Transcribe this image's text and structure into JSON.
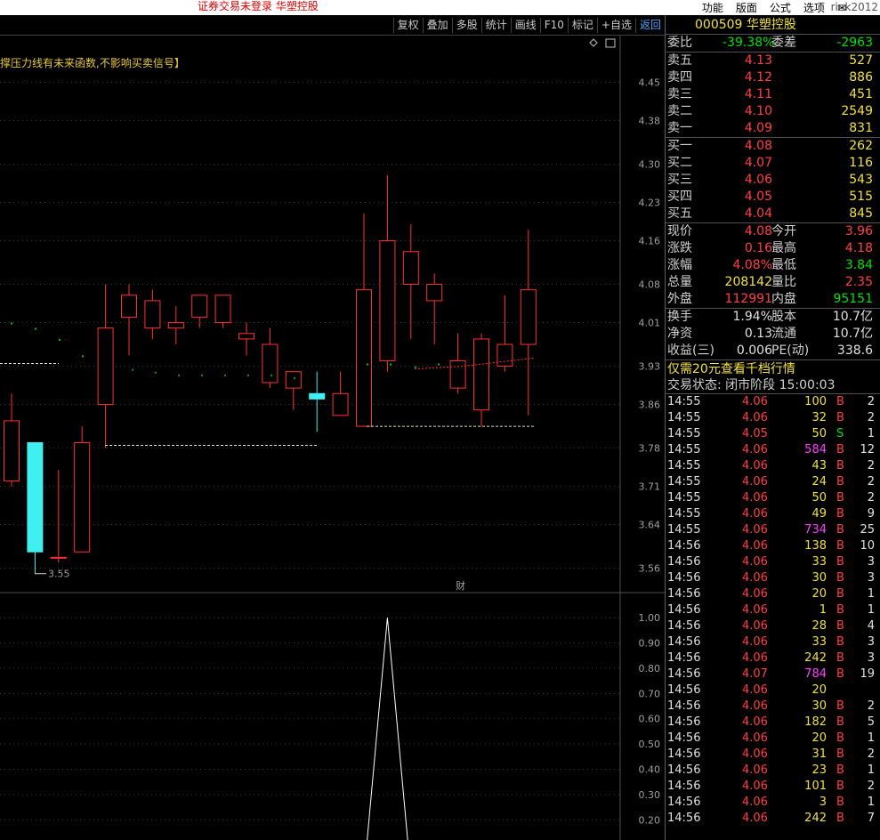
{
  "topbar": {
    "warning": "证券交易未登录  华塑控股",
    "menu": [
      "功能",
      "版面",
      "公式",
      "选项"
    ],
    "user": "rink2012"
  },
  "toolbar": {
    "buttons": [
      "复权",
      "叠加",
      "多股",
      "统计",
      "画线",
      "F10",
      "标记",
      "+自选",
      "返回"
    ],
    "active": "返回"
  },
  "chart": {
    "indicator_note": "撑压力线有未来函数,不影响买卖信号】",
    "price_axis_labels": [
      "4.45",
      "4.38",
      "4.30",
      "4.23",
      "4.16",
      "4.08",
      "4.01",
      "3.93",
      "3.86",
      "3.78",
      "3.71",
      "3.64",
      "3.56"
    ],
    "low_marker": "3.55",
    "finance_marker": "财",
    "sub_axis_labels": [
      "1.00",
      "0.90",
      "0.80",
      "0.70",
      "0.60",
      "0.50",
      "0.40",
      "0.30",
      "0.20"
    ],
    "colors": {
      "up": "#ff3030",
      "down": "#40f0f0",
      "axis": "#a0a0a0",
      "grid": "#505050"
    }
  },
  "chart_data": {
    "type": "candlestick",
    "title": "",
    "ylim": [
      3.53,
      4.49
    ],
    "candles": [
      {
        "o": 3.72,
        "c": 3.83,
        "h": 3.88,
        "l": 3.71
      },
      {
        "o": 3.79,
        "c": 3.59,
        "h": 3.79,
        "l": 3.55
      },
      {
        "o": 3.58,
        "c": 3.58,
        "h": 3.74,
        "l": 3.57
      },
      {
        "o": 3.59,
        "c": 3.79,
        "h": 3.82,
        "l": 3.59
      },
      {
        "o": 3.86,
        "c": 4.0,
        "h": 4.08,
        "l": 3.78
      },
      {
        "o": 4.02,
        "c": 4.06,
        "h": 4.08,
        "l": 3.95
      },
      {
        "o": 4.0,
        "c": 4.05,
        "h": 4.07,
        "l": 3.98
      },
      {
        "o": 4.0,
        "c": 4.01,
        "h": 4.04,
        "l": 3.97
      },
      {
        "o": 4.02,
        "c": 4.06,
        "h": 4.06,
        "l": 4.0
      },
      {
        "o": 4.01,
        "c": 4.06,
        "h": 4.06,
        "l": 4.0
      },
      {
        "o": 3.98,
        "c": 3.99,
        "h": 4.01,
        "l": 3.95
      },
      {
        "o": 3.9,
        "c": 3.97,
        "h": 4.0,
        "l": 3.89
      },
      {
        "o": 3.89,
        "c": 3.92,
        "h": 3.92,
        "l": 3.85
      },
      {
        "o": 3.88,
        "c": 3.87,
        "h": 3.92,
        "l": 3.81
      },
      {
        "o": 3.84,
        "c": 3.88,
        "h": 3.92,
        "l": 3.84
      },
      {
        "o": 3.82,
        "c": 4.07,
        "h": 4.21,
        "l": 3.82
      },
      {
        "o": 3.94,
        "c": 4.16,
        "h": 4.28,
        "l": 3.92
      },
      {
        "o": 4.08,
        "c": 4.14,
        "h": 4.19,
        "l": 3.98
      },
      {
        "o": 4.05,
        "c": 4.08,
        "h": 4.1,
        "l": 3.97
      },
      {
        "o": 3.89,
        "c": 3.94,
        "h": 3.99,
        "l": 3.88
      },
      {
        "o": 3.85,
        "c": 3.98,
        "h": 3.99,
        "l": 3.82
      },
      {
        "o": 3.93,
        "c": 3.97,
        "h": 4.06,
        "l": 3.92
      },
      {
        "o": 3.97,
        "c": 4.07,
        "h": 4.18,
        "l": 3.84
      }
    ],
    "sub_series": [
      0,
      0,
      0,
      0,
      0,
      0,
      0,
      0,
      0,
      0,
      0,
      0,
      0,
      0,
      0,
      0,
      1,
      0,
      0,
      0,
      0,
      0,
      0
    ],
    "sub_ylim": [
      0.12,
      1.05
    ]
  },
  "panel": {
    "code": "000509",
    "name": "华塑控股",
    "ratio": {
      "label1": "委比",
      "val1": "-39.38%",
      "label2": "委差",
      "val2": "-2963"
    },
    "sells": [
      {
        "label": "卖五",
        "price": "4.13",
        "vol": "527"
      },
      {
        "label": "卖四",
        "price": "4.12",
        "vol": "886"
      },
      {
        "label": "卖三",
        "price": "4.11",
        "vol": "451"
      },
      {
        "label": "卖二",
        "price": "4.10",
        "vol": "2549"
      },
      {
        "label": "卖一",
        "price": "4.09",
        "vol": "831"
      }
    ],
    "buys": [
      {
        "label": "买一",
        "price": "4.08",
        "vol": "262"
      },
      {
        "label": "买二",
        "price": "4.07",
        "vol": "116"
      },
      {
        "label": "买三",
        "price": "4.06",
        "vol": "543"
      },
      {
        "label": "买四",
        "price": "4.05",
        "vol": "515"
      },
      {
        "label": "买五",
        "price": "4.04",
        "vol": "845"
      }
    ],
    "stats": [
      {
        "l1": "现价",
        "v1": "4.08",
        "c1": "red",
        "l2": "今开",
        "v2": "3.96",
        "c2": "red"
      },
      {
        "l1": "涨跌",
        "v1": "0.16",
        "c1": "red",
        "l2": "最高",
        "v2": "4.18",
        "c2": "red"
      },
      {
        "l1": "涨幅",
        "v1": "4.08%",
        "c1": "red",
        "l2": "最低",
        "v2": "3.84",
        "c2": "grn"
      },
      {
        "l1": "总量",
        "v1": "208142",
        "c1": "yel",
        "l2": "量比",
        "v2": "2.35",
        "c2": "red"
      },
      {
        "l1": "外盘",
        "v1": "112991",
        "c1": "red",
        "l2": "内盘",
        "v2": "95151",
        "c2": "grn"
      }
    ],
    "stats2": [
      {
        "l1": "换手",
        "v1": "1.94%",
        "l2": "股本",
        "v2": "10.7亿"
      },
      {
        "l1": "净资",
        "v1": "0.13",
        "l2": "流通",
        "v2": "10.7亿"
      },
      {
        "l1": "收益(三)",
        "v1": "0.006",
        "l2": "PE(动)",
        "v2": "338.6"
      }
    ],
    "promo": "仅需20元查看千档行情",
    "state": "交易状态: 闭市阶段 15:00:03",
    "ticks": [
      {
        "t": "14:55",
        "p": "4.06",
        "v": "100",
        "d": "B",
        "n": "2",
        "vc": "yel"
      },
      {
        "t": "14:55",
        "p": "4.06",
        "v": "32",
        "d": "B",
        "n": "2",
        "vc": "yel"
      },
      {
        "t": "14:55",
        "p": "4.05",
        "v": "50",
        "d": "S",
        "n": "1",
        "vc": "yel"
      },
      {
        "t": "14:55",
        "p": "4.06",
        "v": "584",
        "d": "B",
        "n": "12",
        "vc": "mag"
      },
      {
        "t": "14:55",
        "p": "4.06",
        "v": "43",
        "d": "B",
        "n": "2",
        "vc": "yel"
      },
      {
        "t": "14:55",
        "p": "4.06",
        "v": "24",
        "d": "B",
        "n": "2",
        "vc": "yel"
      },
      {
        "t": "14:55",
        "p": "4.06",
        "v": "50",
        "d": "B",
        "n": "2",
        "vc": "yel"
      },
      {
        "t": "14:55",
        "p": "4.06",
        "v": "49",
        "d": "B",
        "n": "9",
        "vc": "yel"
      },
      {
        "t": "14:55",
        "p": "4.06",
        "v": "734",
        "d": "B",
        "n": "25",
        "vc": "mag"
      },
      {
        "t": "14:56",
        "p": "4.06",
        "v": "138",
        "d": "B",
        "n": "10",
        "vc": "yel"
      },
      {
        "t": "14:56",
        "p": "4.06",
        "v": "33",
        "d": "B",
        "n": "3",
        "vc": "yel"
      },
      {
        "t": "14:56",
        "p": "4.06",
        "v": "30",
        "d": "B",
        "n": "3",
        "vc": "yel"
      },
      {
        "t": "14:56",
        "p": "4.06",
        "v": "20",
        "d": "B",
        "n": "1",
        "vc": "yel"
      },
      {
        "t": "14:56",
        "p": "4.06",
        "v": "1",
        "d": "B",
        "n": "1",
        "vc": "yel"
      },
      {
        "t": "14:56",
        "p": "4.06",
        "v": "28",
        "d": "B",
        "n": "4",
        "vc": "yel"
      },
      {
        "t": "14:56",
        "p": "4.06",
        "v": "33",
        "d": "B",
        "n": "3",
        "vc": "yel"
      },
      {
        "t": "14:56",
        "p": "4.06",
        "v": "242",
        "d": "B",
        "n": "3",
        "vc": "yel"
      },
      {
        "t": "14:56",
        "p": "4.07",
        "v": "784",
        "d": "B",
        "n": "19",
        "vc": "mag"
      },
      {
        "t": "14:56",
        "p": "4.06",
        "v": "20",
        "d": "",
        "n": "",
        "vc": "yel"
      },
      {
        "t": "14:56",
        "p": "4.06",
        "v": "30",
        "d": "B",
        "n": "2",
        "vc": "yel"
      },
      {
        "t": "14:56",
        "p": "4.06",
        "v": "182",
        "d": "B",
        "n": "5",
        "vc": "yel"
      },
      {
        "t": "14:56",
        "p": "4.06",
        "v": "20",
        "d": "B",
        "n": "1",
        "vc": "yel"
      },
      {
        "t": "14:56",
        "p": "4.06",
        "v": "31",
        "d": "B",
        "n": "2",
        "vc": "yel"
      },
      {
        "t": "14:56",
        "p": "4.06",
        "v": "23",
        "d": "B",
        "n": "1",
        "vc": "yel"
      },
      {
        "t": "14:56",
        "p": "4.06",
        "v": "101",
        "d": "B",
        "n": "2",
        "vc": "yel"
      },
      {
        "t": "14:56",
        "p": "4.06",
        "v": "3",
        "d": "B",
        "n": "1",
        "vc": "yel"
      },
      {
        "t": "14:56",
        "p": "4.06",
        "v": "242",
        "d": "B",
        "n": "7",
        "vc": "yel"
      }
    ]
  }
}
